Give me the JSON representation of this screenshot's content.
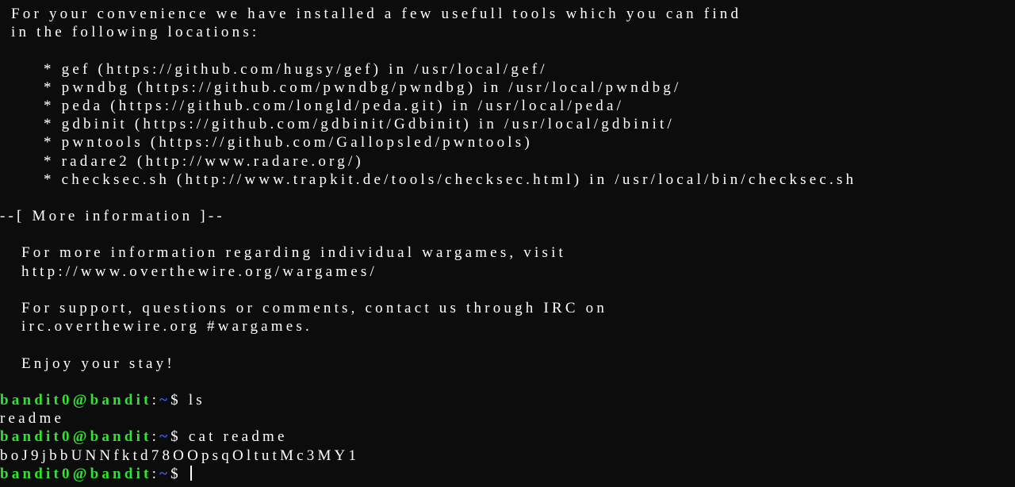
{
  "terminal": {
    "intro": [
      "For your convenience we have installed a few usefull tools which you can find",
      "in the following locations:"
    ],
    "tools": [
      "* gef (https://github.com/hugsy/gef) in /usr/local/gef/",
      "* pwndbg (https://github.com/pwndbg/pwndbg) in /usr/local/pwndbg/",
      "* peda (https://github.com/longld/peda.git) in /usr/local/peda/",
      "* gdbinit (https://github.com/gdbinit/Gdbinit) in /usr/local/gdbinit/",
      "* pwntools (https://github.com/Gallopsled/pwntools)",
      "* radare2 (http://www.radare.org/)",
      "* checksec.sh (http://www.trapkit.de/tools/checksec.html) in /usr/local/bin/checksec.sh"
    ],
    "more_info_heading": "--[ More information ]--",
    "more_info": [
      "For more information regarding individual wargames, visit",
      "http://www.overthewire.org/wargames/"
    ],
    "support": [
      "For support, questions or comments, contact us through IRC on",
      "irc.overthewire.org #wargames."
    ],
    "enjoy": "Enjoy your stay!",
    "prompt": {
      "user_host": "bandit0@bandit",
      "sep": ":",
      "path": "~",
      "symbol": "$"
    },
    "session": [
      {
        "command": "ls",
        "output": "readme"
      },
      {
        "command": "cat readme",
        "output": "boJ9jbbUNNfktd78OOpsqOltutMc3MY1"
      }
    ],
    "current_input": ""
  },
  "colors": {
    "background": "#0c0c0c",
    "text": "#ffffff",
    "prompt_user": "#2ee62e",
    "prompt_path": "#3b5ff0"
  }
}
